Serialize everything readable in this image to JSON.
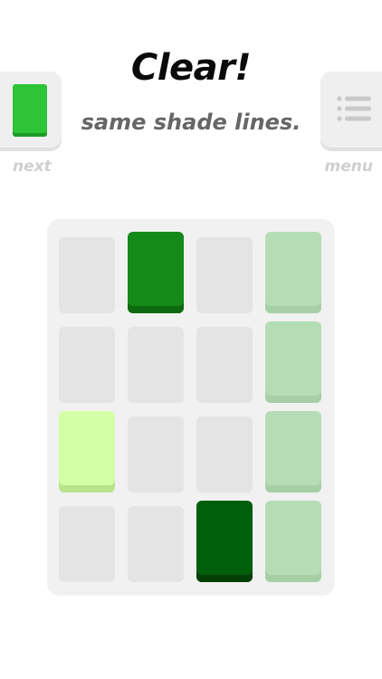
{
  "header": {
    "title": "Clear!",
    "subtitle": "same shade lines."
  },
  "next_button": {
    "label": "next",
    "preview_color": "#2ec437"
  },
  "menu_button": {
    "label": "menu",
    "icon": "menu-list-icon"
  },
  "board": {
    "rows": 4,
    "cols": 4,
    "tiles": [
      {
        "row": 0,
        "col": 1,
        "color": "#148a18",
        "shadow": "#0b6a10",
        "name": "tile-green-medium"
      },
      {
        "row": 0,
        "col": 3,
        "color": "#b5ddb5",
        "shadow": "#a6cfa6",
        "name": "tile-green-faded"
      },
      {
        "row": 1,
        "col": 3,
        "color": "#b5ddb5",
        "shadow": "#a6cfa6",
        "name": "tile-green-faded"
      },
      {
        "row": 2,
        "col": 0,
        "color": "#d4ffa6",
        "shadow": "#b8e58c",
        "name": "tile-lime-light"
      },
      {
        "row": 2,
        "col": 3,
        "color": "#b5ddb5",
        "shadow": "#a6cfa6",
        "name": "tile-green-faded"
      },
      {
        "row": 3,
        "col": 2,
        "color": "#015f0b",
        "shadow": "#013f06",
        "name": "tile-green-dark"
      },
      {
        "row": 3,
        "col": 3,
        "color": "#b5ddb5",
        "shadow": "#a6cfa6",
        "name": "tile-green-faded"
      }
    ]
  }
}
